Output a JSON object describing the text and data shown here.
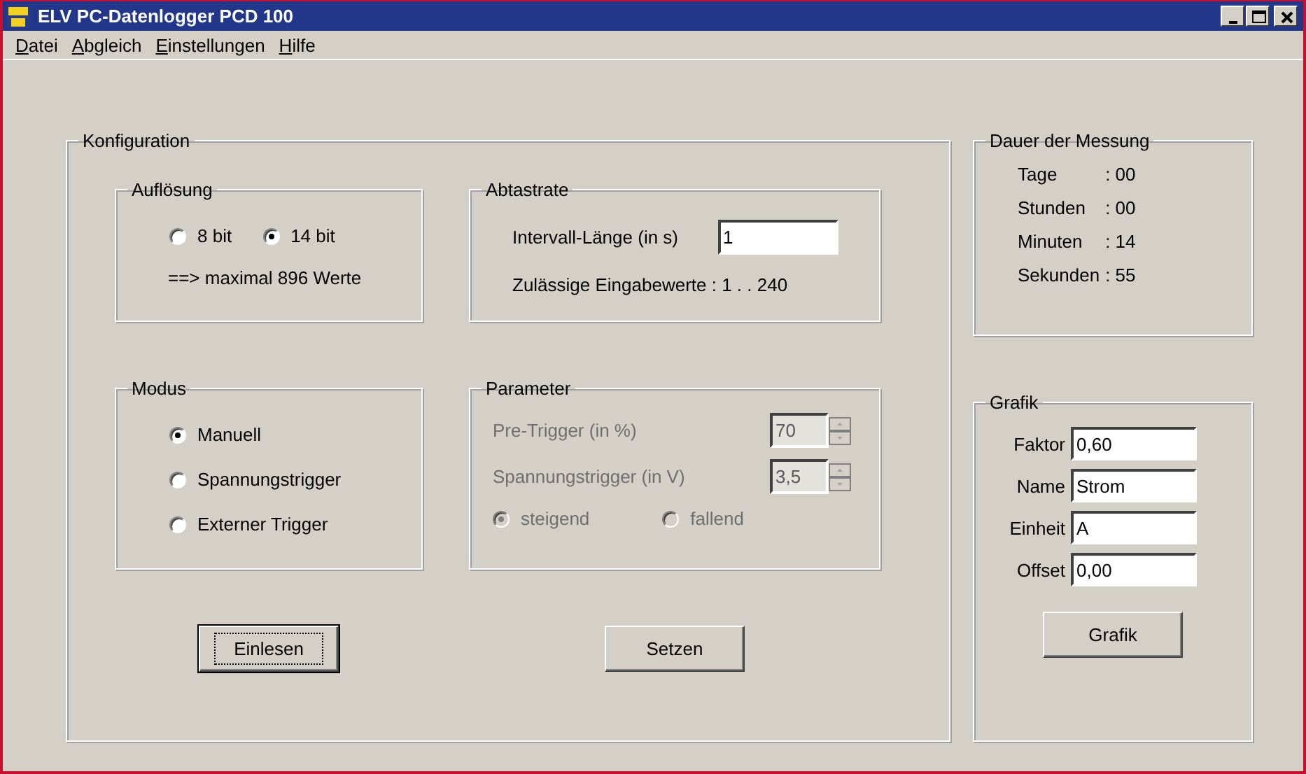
{
  "window": {
    "title": "ELV PC-Datenlogger PCD 100"
  },
  "menu": [
    {
      "label": "Datei"
    },
    {
      "label": "Abgleich"
    },
    {
      "label": "Einstellungen"
    },
    {
      "label": "Hilfe"
    }
  ],
  "konfiguration": {
    "title": "Konfiguration",
    "aufloesung": {
      "title": "Auflösung",
      "options": [
        {
          "label": "8 bit",
          "selected": false
        },
        {
          "label": "14 bit",
          "selected": true
        }
      ],
      "note": "==> maximal 896 Werte"
    },
    "abtastrate": {
      "title": "Abtastrate",
      "field_label": "Intervall-Länge (in s)",
      "value": "1",
      "hint": "Zulässige Eingabewerte : 1 . . 240"
    },
    "modus": {
      "title": "Modus",
      "options": [
        {
          "label": "Manuell",
          "selected": true
        },
        {
          "label": "Spannungstrigger",
          "selected": false
        },
        {
          "label": "Externer Trigger",
          "selected": false
        }
      ]
    },
    "parameter": {
      "title": "Parameter",
      "disabled": true,
      "spinners": [
        {
          "label": "Pre-Trigger (in %)",
          "value": "70"
        },
        {
          "label": "Spannungstrigger (in V)",
          "value": "3,5"
        }
      ],
      "edges": [
        {
          "label": "steigend",
          "selected": true
        },
        {
          "label": "fallend",
          "selected": false
        }
      ]
    },
    "buttons": [
      {
        "label": "Einlesen",
        "focused": true
      },
      {
        "label": "Setzen",
        "focused": false
      }
    ]
  },
  "dauer": {
    "title": "Dauer der Messung",
    "rows": [
      {
        "label": "Tage",
        "value": ": 00"
      },
      {
        "label": "Stunden",
        "value": ": 00"
      },
      {
        "label": "Minuten",
        "value": ": 14"
      },
      {
        "label": "Sekunden",
        "value": ": 55"
      }
    ]
  },
  "grafik": {
    "title": "Grafik",
    "fields": [
      {
        "label": "Faktor",
        "value": "0,60"
      },
      {
        "label": "Name",
        "value": "Strom"
      },
      {
        "label": "Einheit",
        "value": "A"
      },
      {
        "label": "Offset",
        "value": "0,00"
      }
    ],
    "button": {
      "label": "Grafik",
      "focused": false
    }
  }
}
